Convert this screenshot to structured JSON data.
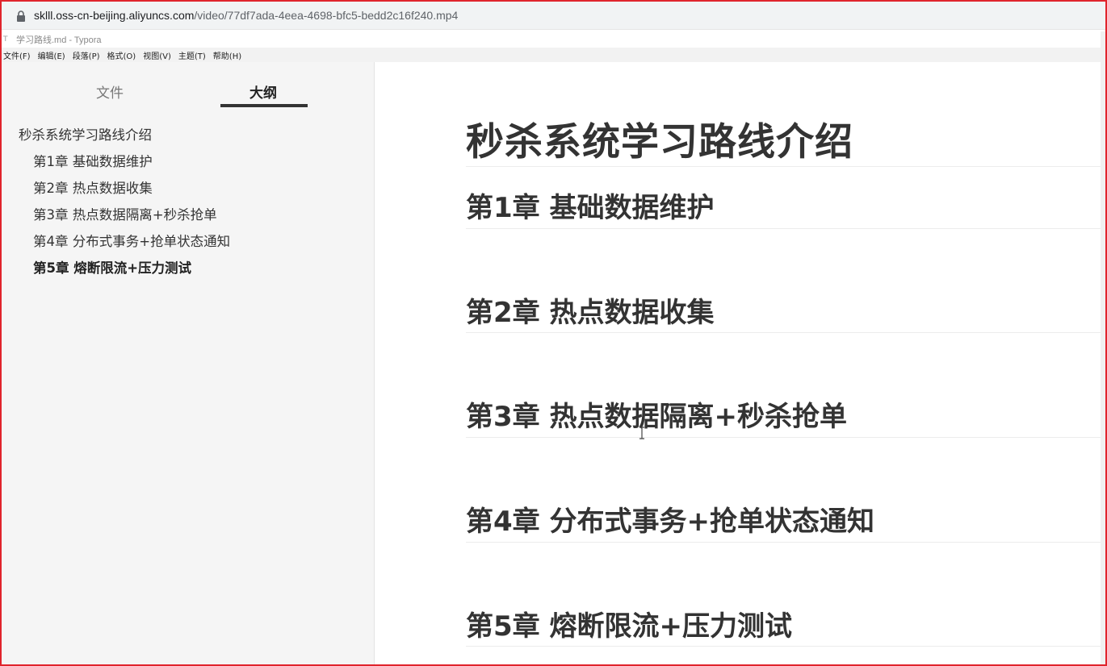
{
  "browser": {
    "url_host": "sklll.oss-cn-beijing.aliyuncs.com",
    "url_path": "/video/77df7ada-4eea-4698-bfc5-bedd2c16f240.mp4"
  },
  "window": {
    "app_icon": "T",
    "title": "学习路线.md - Typora"
  },
  "menu": [
    "文件(F)",
    "编辑(E)",
    "段落(P)",
    "格式(O)",
    "视图(V)",
    "主题(T)",
    "帮助(H)"
  ],
  "sidebar": {
    "tabs": {
      "files": "文件",
      "outline": "大纲"
    },
    "active_tab": "outline",
    "outline": [
      {
        "label": "秒杀系统学习路线介绍",
        "level": 1
      },
      {
        "label": "第1章 基础数据维护",
        "level": 2
      },
      {
        "label": "第2章 热点数据收集",
        "level": 2
      },
      {
        "label": "第3章 热点数据隔离+秒杀抢单",
        "level": 2
      },
      {
        "label": "第4章 分布式事务+抢单状态通知",
        "level": 2
      },
      {
        "label": "第5章 熔断限流+压力测试",
        "level": 2,
        "active": true
      }
    ]
  },
  "document": {
    "h1": "秒杀系统学习路线介绍",
    "h2": [
      "第1章  基础数据维护",
      "第2章 热点数据收集",
      "第3章 热点数据隔离+秒杀抢单",
      "第4章 分布式事务+抢单状态通知",
      "第5章 熔断限流+压力测试"
    ]
  },
  "colors": {
    "frame_border": "#e0242c",
    "sidebar_bg": "#f5f5f5",
    "heading_text": "#333333"
  }
}
